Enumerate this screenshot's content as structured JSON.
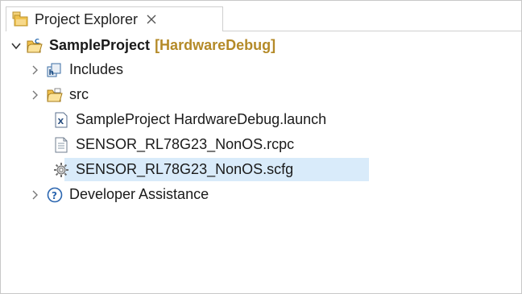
{
  "view": {
    "tab_label": "Project Explorer",
    "tab_icon": "project-explorer-icon",
    "close_icon": "close-icon"
  },
  "tree": {
    "project": {
      "name": "SampleProject",
      "decoration": "[HardwareDebug]",
      "icon": "c-project-folder-icon",
      "expanded": true
    },
    "children": [
      {
        "label": "Includes",
        "icon": "includes-icon",
        "expandable": true
      },
      {
        "label": "src",
        "icon": "source-folder-icon",
        "expandable": true
      },
      {
        "label": "SampleProject HardwareDebug.launch",
        "icon": "launch-file-icon",
        "expandable": false
      },
      {
        "label": "SENSOR_RL78G23_NonOS.rcpc",
        "icon": "text-file-icon",
        "expandable": false
      },
      {
        "label": "SENSOR_RL78G23_NonOS.scfg",
        "icon": "gear-file-icon",
        "expandable": false,
        "selected": true
      },
      {
        "label": "Developer Assistance",
        "icon": "help-icon",
        "expandable": true
      }
    ]
  },
  "colors": {
    "selection": "#d9ebfa",
    "decoration": "#b48a28",
    "border": "#cfcfcf"
  }
}
